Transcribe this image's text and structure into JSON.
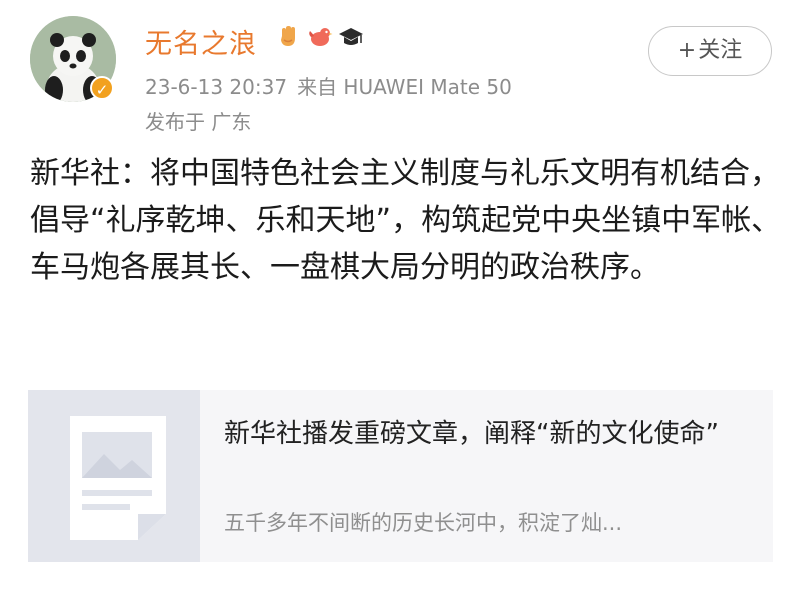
{
  "post": {
    "username": "无名之浪",
    "timestamp": "23-6-13 20:37",
    "source": "来自 HUAWEI Mate 50",
    "location": "发布于 广东",
    "follow_plus": "+",
    "follow_label": "关注",
    "text": "新华社：将中国特色社会主义制度与礼乐文明有机结合，倡导“礼序乾坤、乐和天地”，构筑起党中央坐镇中军帐、车马炮各展其长、一盘棋大局分明的政治秩序。",
    "badges": [
      "hand-badge-icon",
      "bird-badge-icon",
      "graduation-cap-badge-icon"
    ],
    "verified_icon": "verified-badge-icon"
  },
  "link_card": {
    "title": "新华社播发重磅文章，阐释“新的文化使命”",
    "description": "五千多年不间断的历史长河中，积淀了灿...",
    "thumbnail_icon": "article-thumbnail-icon"
  },
  "colors": {
    "username": "#e8792e",
    "meta": "#8c8c8c",
    "verified": "#f2a11f",
    "card_bg": "#f6f6f8"
  }
}
